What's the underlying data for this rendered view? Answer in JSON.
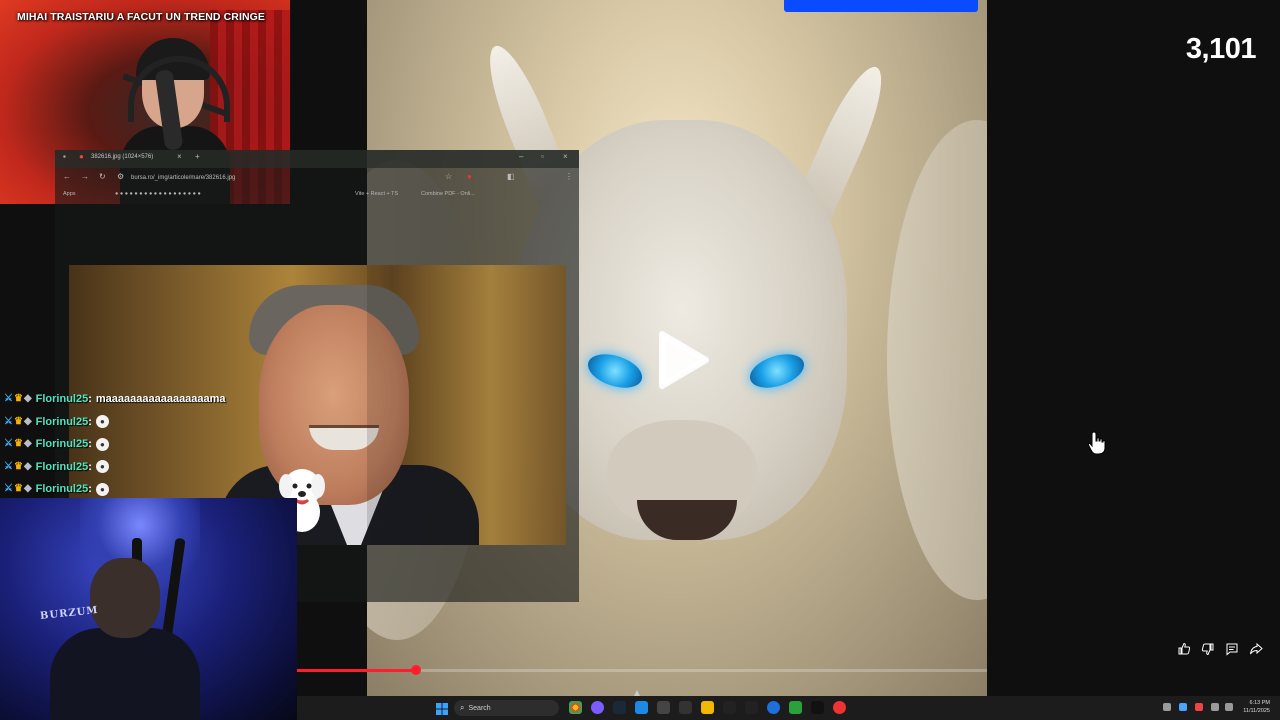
{
  "stream": {
    "title": "MIHAI TRAISTARIU A FACUT UN TREND CRINGE",
    "view_count": "3,101"
  },
  "browser": {
    "tab_title": "382616.jpg (1024×576)",
    "url": "bursa.ro/_img/articole/mare/382616.jpg",
    "bookmarks": [
      "Apps",
      "Vite + React + TS",
      "Combine PDF - Onli..."
    ]
  },
  "chat": {
    "messages": [
      {
        "user": "Florinul25",
        "text": "maaaaaaaaaaaaaaaaama",
        "emote": false
      },
      {
        "user": "Florinul25",
        "text": "",
        "emote": true
      },
      {
        "user": "Florinul25",
        "text": "",
        "emote": true
      },
      {
        "user": "Florinul25",
        "text": "",
        "emote": true
      },
      {
        "user": "Florinul25",
        "text": "",
        "emote": true
      }
    ],
    "badge_icons": [
      "sword-icon",
      "crown-icon",
      "gem-icon"
    ]
  },
  "video": {
    "progress": 0.173
  },
  "taskbar": {
    "search_label": "Search",
    "time": "6:13 PM",
    "date": "11/11/2025"
  },
  "colors": {
    "progress": "#ff1e2d",
    "chat_username": "#4fe3c0",
    "video_top_bar": "#0a4bff"
  }
}
